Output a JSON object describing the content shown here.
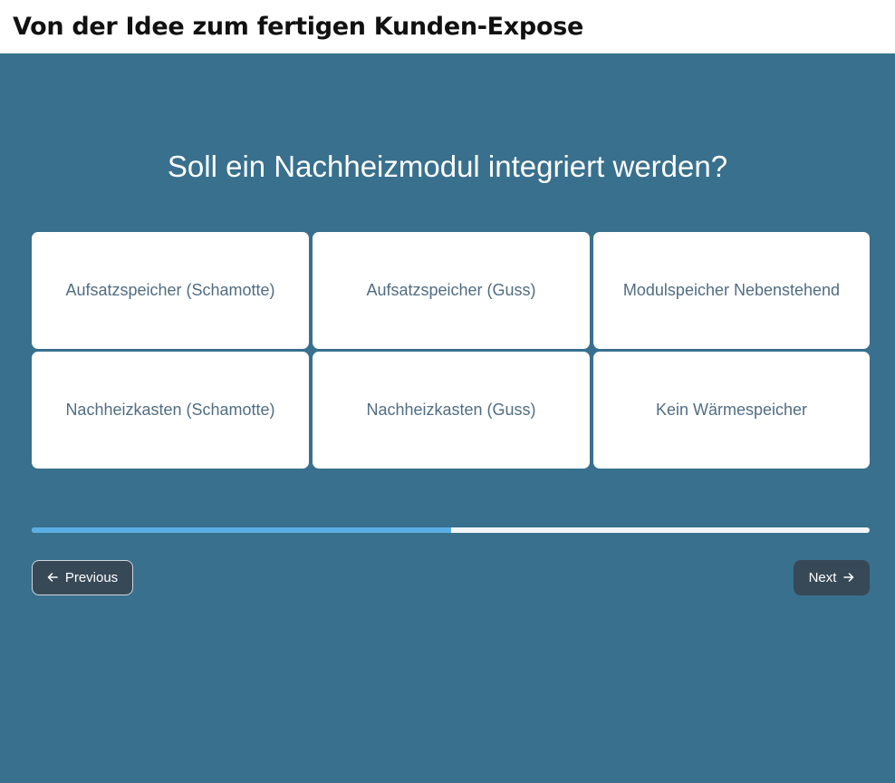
{
  "header": {
    "title": "Von der Idee zum fertigen Kunden-Expose"
  },
  "question": {
    "text": "Soll ein Nachheizmodul integriert werden?"
  },
  "options": [
    {
      "label": "Aufsatzspeicher (Schamotte)"
    },
    {
      "label": "Aufsatzspeicher (Guss)"
    },
    {
      "label": "Modulspeicher Nebenstehend"
    },
    {
      "label": "Nachheizkasten (Schamotte)"
    },
    {
      "label": "Nachheizkasten (Guss)"
    },
    {
      "label": "Kein Wärmespeicher"
    }
  ],
  "progress": {
    "fraction": 0.5
  },
  "nav": {
    "previous_label": "Previous",
    "previous_icon": "arrow-left-icon",
    "next_label": "Next",
    "next_icon": "arrow-right-icon"
  },
  "colors": {
    "background": "#38708e",
    "progress_fill": "#5aaee4",
    "progress_track": "#f2f5f7",
    "button_bg": "#374957",
    "option_text": "#516d82"
  }
}
